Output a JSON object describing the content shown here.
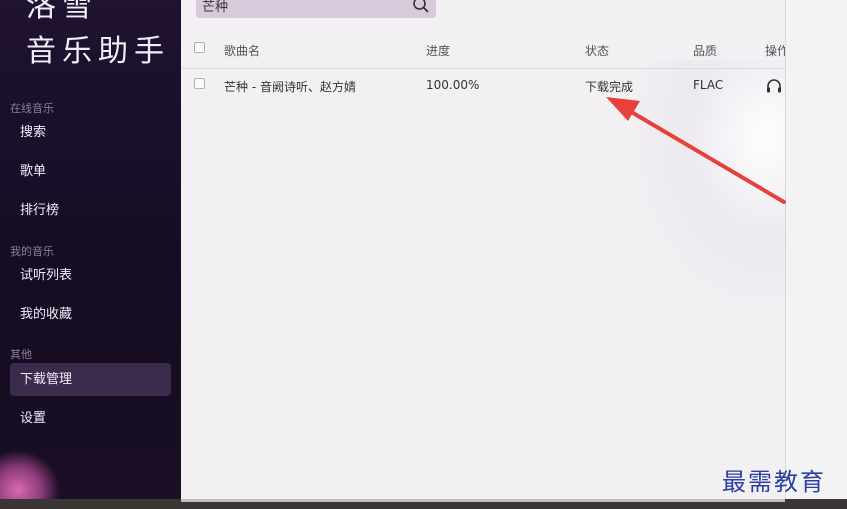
{
  "app": {
    "title_line1": "洛雪",
    "title_line2": "音乐助手"
  },
  "sidebar": {
    "sections": [
      {
        "label": "在线音乐",
        "items": [
          "搜索",
          "歌单",
          "排行榜"
        ]
      },
      {
        "label": "我的音乐",
        "items": [
          "试听列表",
          "我的收藏"
        ]
      },
      {
        "label": "其他",
        "items": [
          "下载管理",
          "设置"
        ]
      }
    ],
    "active_item": "下载管理"
  },
  "search": {
    "value": "芒种",
    "icon": "search-icon"
  },
  "table": {
    "headers": {
      "song": "歌曲名",
      "progress": "进度",
      "status": "状态",
      "quality": "品质",
      "actions": "操作"
    },
    "rows": [
      {
        "song": "芒种 - 音阙诗听、赵方婧",
        "progress": "100.00%",
        "status": "下载完成",
        "quality": "FLAC",
        "action_icon": "headphone-icon"
      }
    ]
  },
  "annotation": {
    "arrow_color": "#e8403a"
  },
  "watermark": "最需教育"
}
